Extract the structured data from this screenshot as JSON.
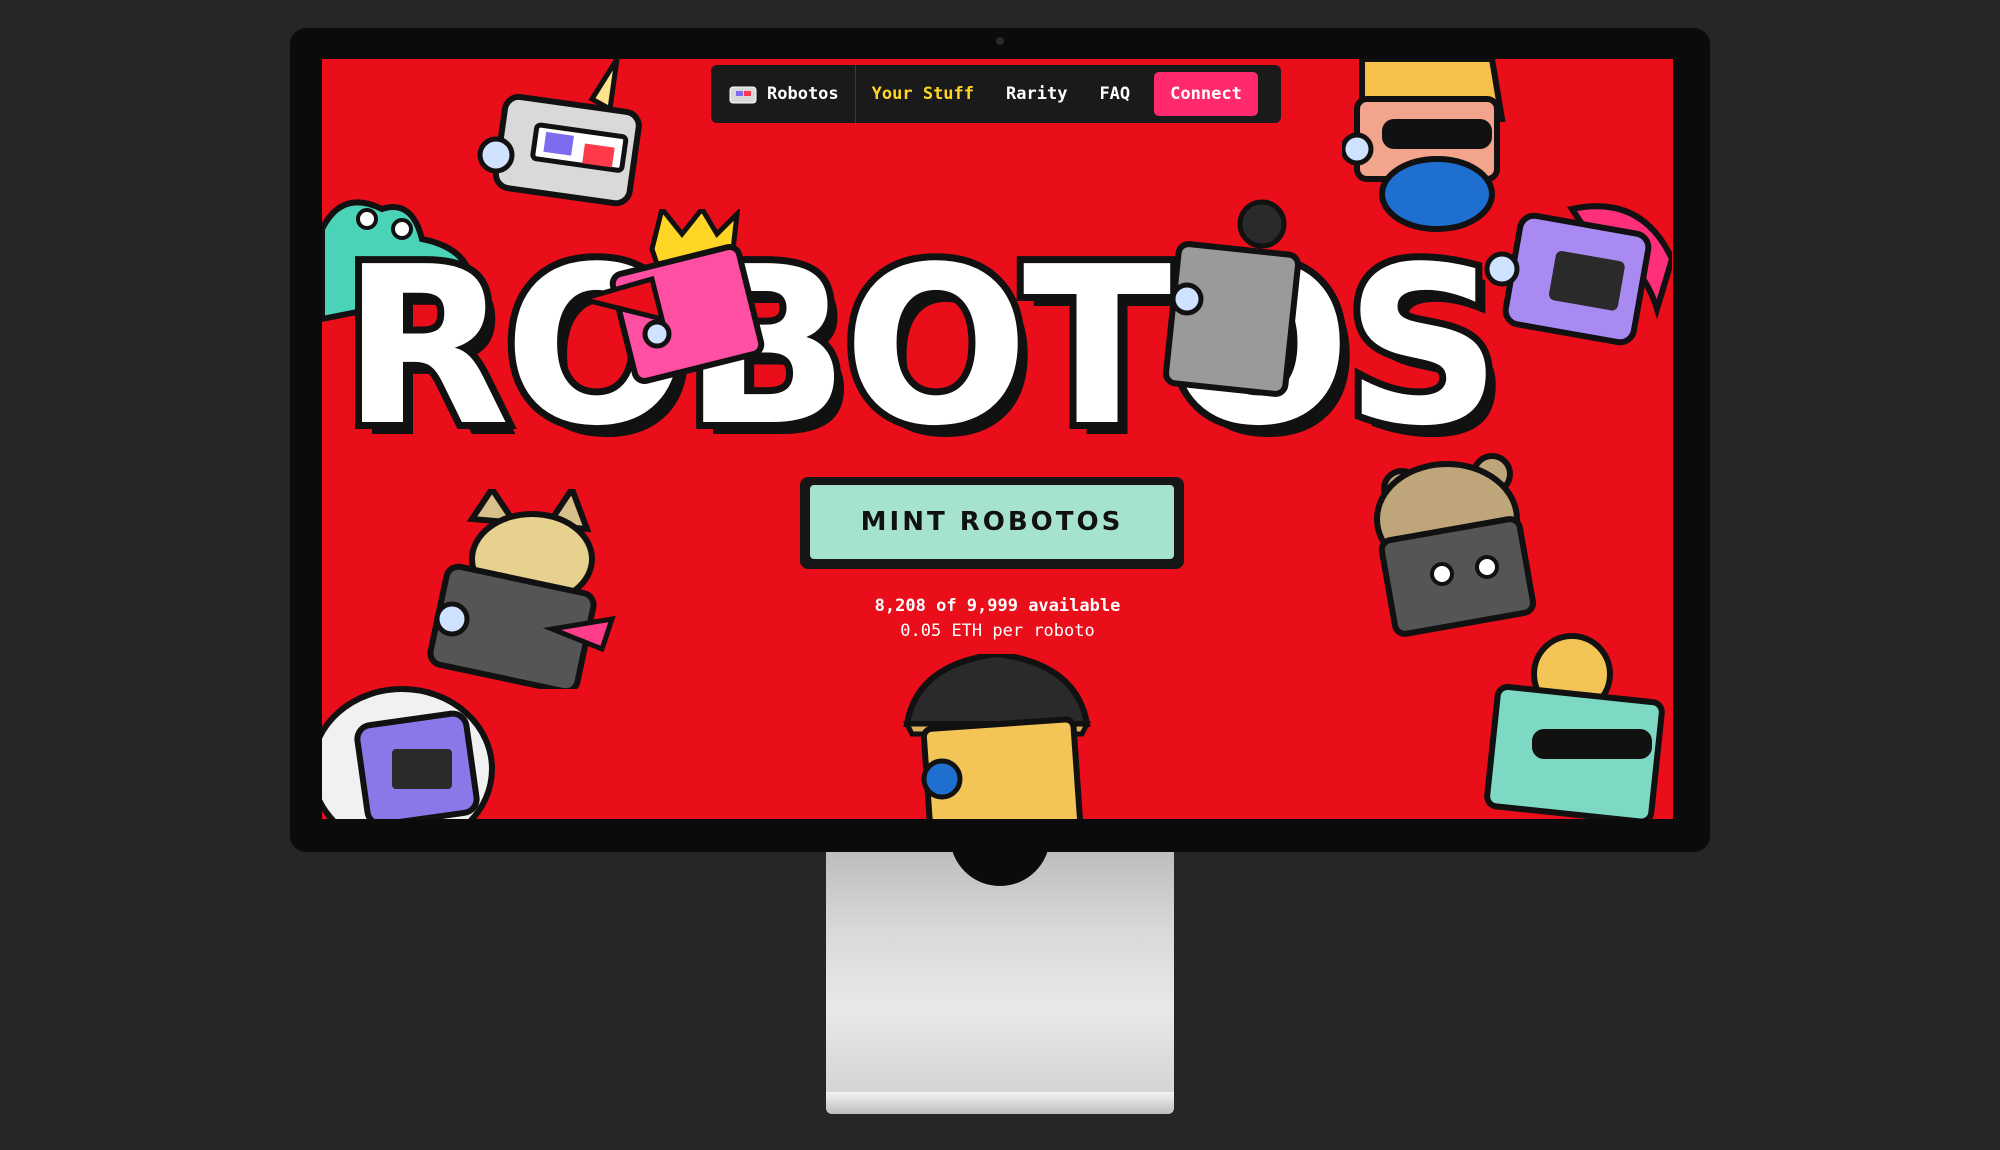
{
  "nav": {
    "brand": "Robotos",
    "items": [
      "Your Stuff",
      "Rarity",
      "FAQ"
    ],
    "connect": "Connect"
  },
  "hero": {
    "title": "ROBOTOS",
    "mint_label": "MINT ROBOTOS",
    "availability": "8,208 of 9,999 available",
    "price": "0.05 ETH per roboto"
  },
  "colors": {
    "background": "#e90e1a",
    "accent_yellow": "#ffd526",
    "connect_pink": "#ff2a6d",
    "mint_green": "#a6e3cf"
  }
}
